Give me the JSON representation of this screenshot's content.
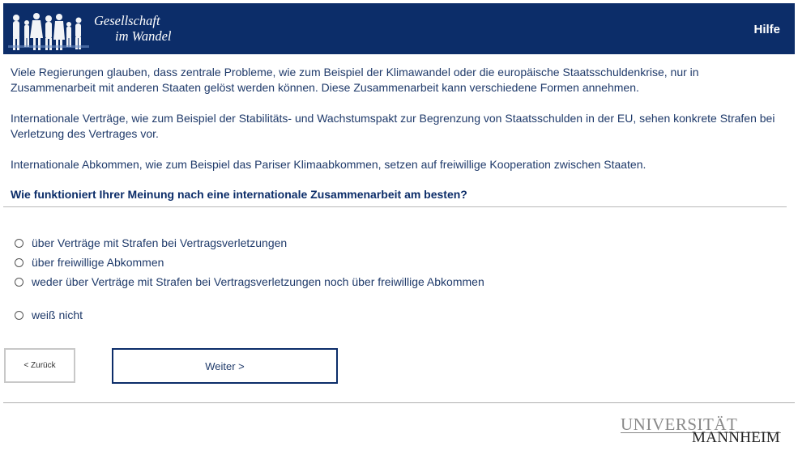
{
  "header": {
    "logo_line1": "Gesellschaft",
    "logo_line2": "im Wandel",
    "help_label": "Hilfe"
  },
  "intro": {
    "p1": "Viele Regierungen glauben, dass zentrale Probleme, wie zum Beispiel der Klimawandel oder die europäische Staatsschuldenkrise, nur in Zusammenarbeit mit anderen Staaten gelöst werden können. Diese Zusammenarbeit kann verschiedene Formen annehmen.",
    "p2": "Internationale Verträge, wie zum Beispiel der Stabilitäts- und Wachstumspakt zur Begrenzung von Staatsschulden in der EU, sehen konkrete Strafen bei Verletzung des Vertrages vor.",
    "p3": "Internationale Abkommen, wie zum Beispiel das Pariser Klimaabkommen, setzen auf freiwillige Kooperation zwischen Staaten."
  },
  "question": "Wie funktioniert Ihrer Meinung nach eine internationale Zusammenarbeit am besten?",
  "options": [
    {
      "label": "über Verträge mit Strafen bei Vertragsverletzungen",
      "selected": false
    },
    {
      "label": "über freiwillige Abkommen",
      "selected": false
    },
    {
      "label": "weder über Verträge mit Strafen bei Vertragsverletzungen noch über freiwillige Abkommen",
      "selected": false
    },
    {
      "label": "weiß nicht",
      "selected": false
    }
  ],
  "nav": {
    "back_label": "< Zurück",
    "next_label": "Weiter >"
  },
  "footer": {
    "uni_line1": "UNIVERSITÄT",
    "uni_line2": "MANNHEIM"
  },
  "colors": {
    "header_bg": "#0c2d69",
    "text": "#1f3a6a"
  }
}
